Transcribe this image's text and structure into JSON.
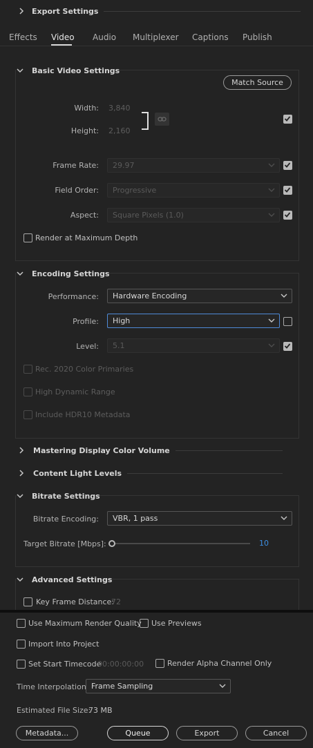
{
  "export_settings": {
    "title": "Export Settings"
  },
  "tabs": [
    {
      "label": "Effects"
    },
    {
      "label": "Video"
    },
    {
      "label": "Audio"
    },
    {
      "label": "Multiplexer"
    },
    {
      "label": "Captions"
    },
    {
      "label": "Publish"
    }
  ],
  "basic_video": {
    "title": "Basic Video Settings",
    "match_source": "Match Source",
    "width_label": "Width:",
    "width_value": "3,840",
    "height_label": "Height:",
    "height_value": "2,160",
    "frame_rate_label": "Frame Rate:",
    "frame_rate_value": "29.97",
    "field_order_label": "Field Order:",
    "field_order_value": "Progressive",
    "aspect_label": "Aspect:",
    "aspect_value": "Square Pixels (1.0)",
    "render_max_depth": "Render at Maximum Depth"
  },
  "encoding": {
    "title": "Encoding Settings",
    "performance_label": "Performance:",
    "performance_value": "Hardware Encoding",
    "profile_label": "Profile:",
    "profile_value": "High",
    "level_label": "Level:",
    "level_value": "5.1",
    "rec2020": "Rec. 2020 Color Primaries",
    "hdr": "High Dynamic Range",
    "hdr10": "Include HDR10 Metadata"
  },
  "mastering": {
    "title": "Mastering Display Color Volume"
  },
  "content_light": {
    "title": "Content Light Levels"
  },
  "bitrate": {
    "title": "Bitrate Settings",
    "encoding_label": "Bitrate Encoding:",
    "encoding_value": "VBR, 1 pass",
    "target_label": "Target Bitrate [Mbps]:",
    "target_value": "10"
  },
  "advanced": {
    "title": "Advanced Settings",
    "key_frame_label": "Key Frame Distance:",
    "key_frame_value": "72"
  },
  "footer": {
    "max_render_quality": "Use Maximum Render Quality",
    "use_previews": "Use Previews",
    "import_project": "Import Into Project",
    "set_start_timecode": "Set Start Timecode",
    "timecode_value": "00:00:00:00",
    "render_alpha": "Render Alpha Channel Only",
    "time_interp_label": "Time Interpolation:",
    "time_interp_value": "Frame Sampling",
    "est_size_label": "Estimated File Size:",
    "est_size_value": "73 MB",
    "metadata_btn": "Metadata...",
    "queue_btn": "Queue",
    "export_btn": "Export",
    "cancel_btn": "Cancel"
  }
}
